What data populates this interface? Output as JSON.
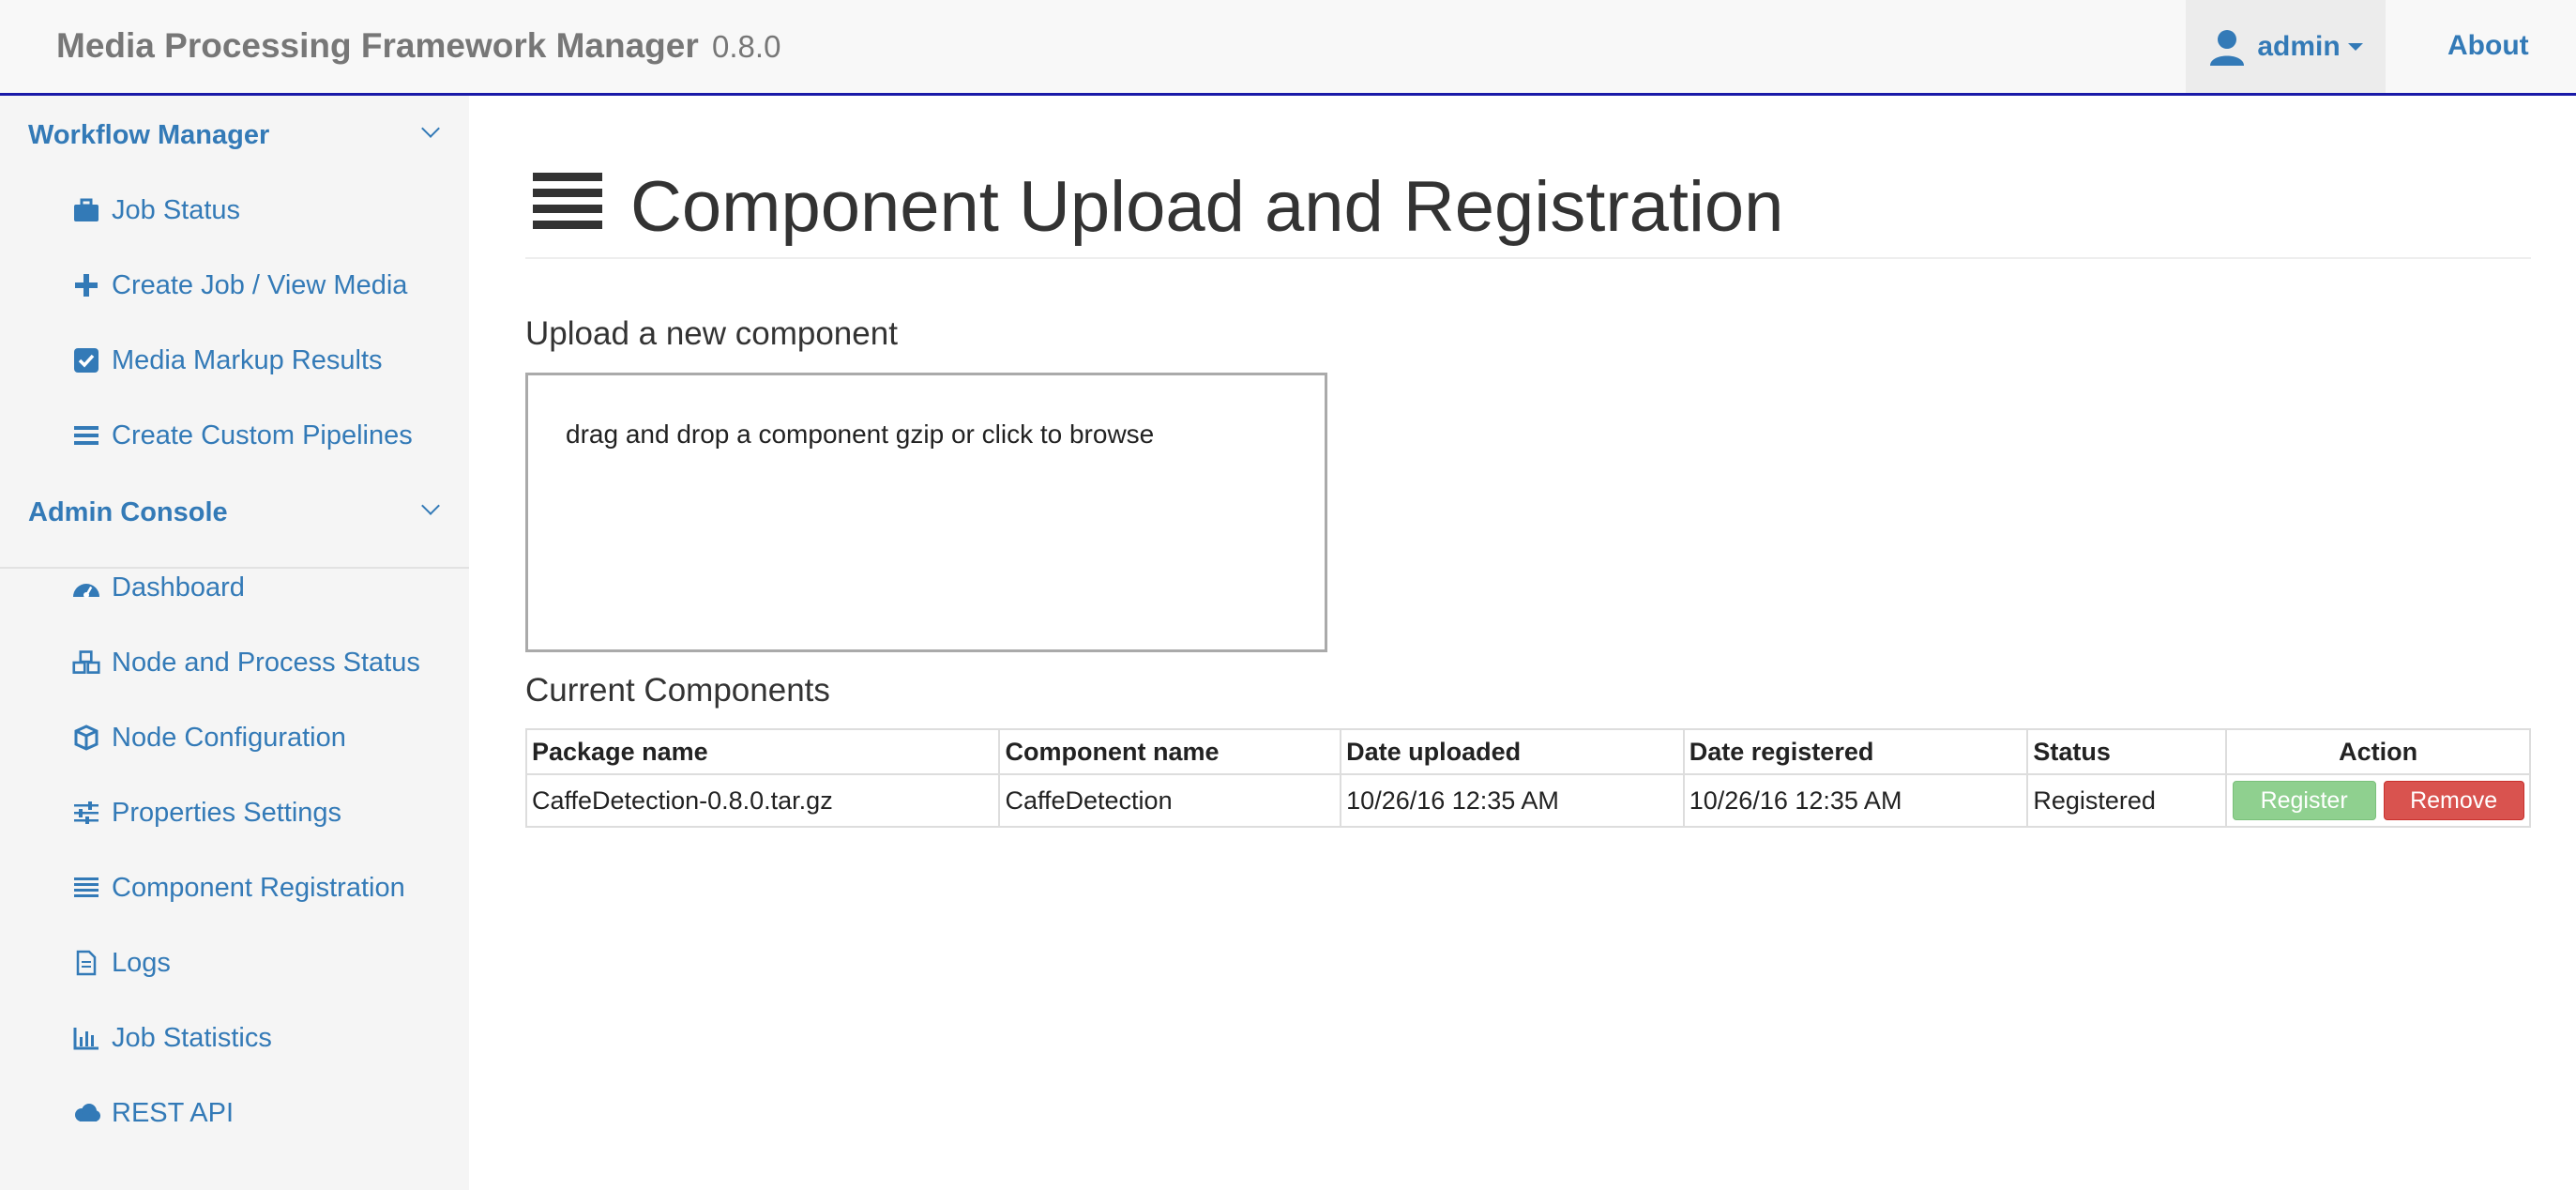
{
  "navbar": {
    "brand": "Media Processing Framework Manager",
    "version": "0.8.0",
    "user": "admin",
    "about": "About"
  },
  "sidebar": {
    "workflow_title": "Workflow Manager",
    "workflow_items": [
      {
        "label": "Job Status",
        "icon": "briefcase-icon"
      },
      {
        "label": "Create Job / View Media",
        "icon": "plus-icon"
      },
      {
        "label": "Media Markup Results",
        "icon": "check-square-icon"
      },
      {
        "label": "Create Custom Pipelines",
        "icon": "list-icon"
      }
    ],
    "admin_title": "Admin Console",
    "admin_items": [
      {
        "label": "Dashboard",
        "icon": "dashboard-icon"
      },
      {
        "label": "Node and Process Status",
        "icon": "cubes-icon"
      },
      {
        "label": "Node Configuration",
        "icon": "cube-icon"
      },
      {
        "label": "Properties Settings",
        "icon": "sliders-icon"
      },
      {
        "label": "Component Registration",
        "icon": "list-icon"
      },
      {
        "label": "Logs",
        "icon": "file-icon"
      },
      {
        "label": "Job Statistics",
        "icon": "bar-chart-icon"
      },
      {
        "label": "REST API",
        "icon": "cloud-icon"
      }
    ]
  },
  "main": {
    "title": "Component Upload and Registration",
    "upload_heading": "Upload a new component",
    "dropzone_text": "drag and drop a component gzip or click to browse",
    "current_heading": "Current Components",
    "table": {
      "columns": [
        "Package name",
        "Component name",
        "Date uploaded",
        "Date registered",
        "Status",
        "Action"
      ],
      "rows": [
        {
          "package": "CaffeDetection-0.8.0.tar.gz",
          "component": "CaffeDetection",
          "uploaded": "10/26/16 12:35 AM",
          "registered": "10/26/16 12:35 AM",
          "status": "Registered",
          "register_label": "Register",
          "remove_label": "Remove"
        }
      ]
    }
  },
  "colors": {
    "link": "#337ab7",
    "navbar_border": "#1a1aa8",
    "register_btn": "#8fd08f",
    "remove_btn": "#d9534f"
  }
}
